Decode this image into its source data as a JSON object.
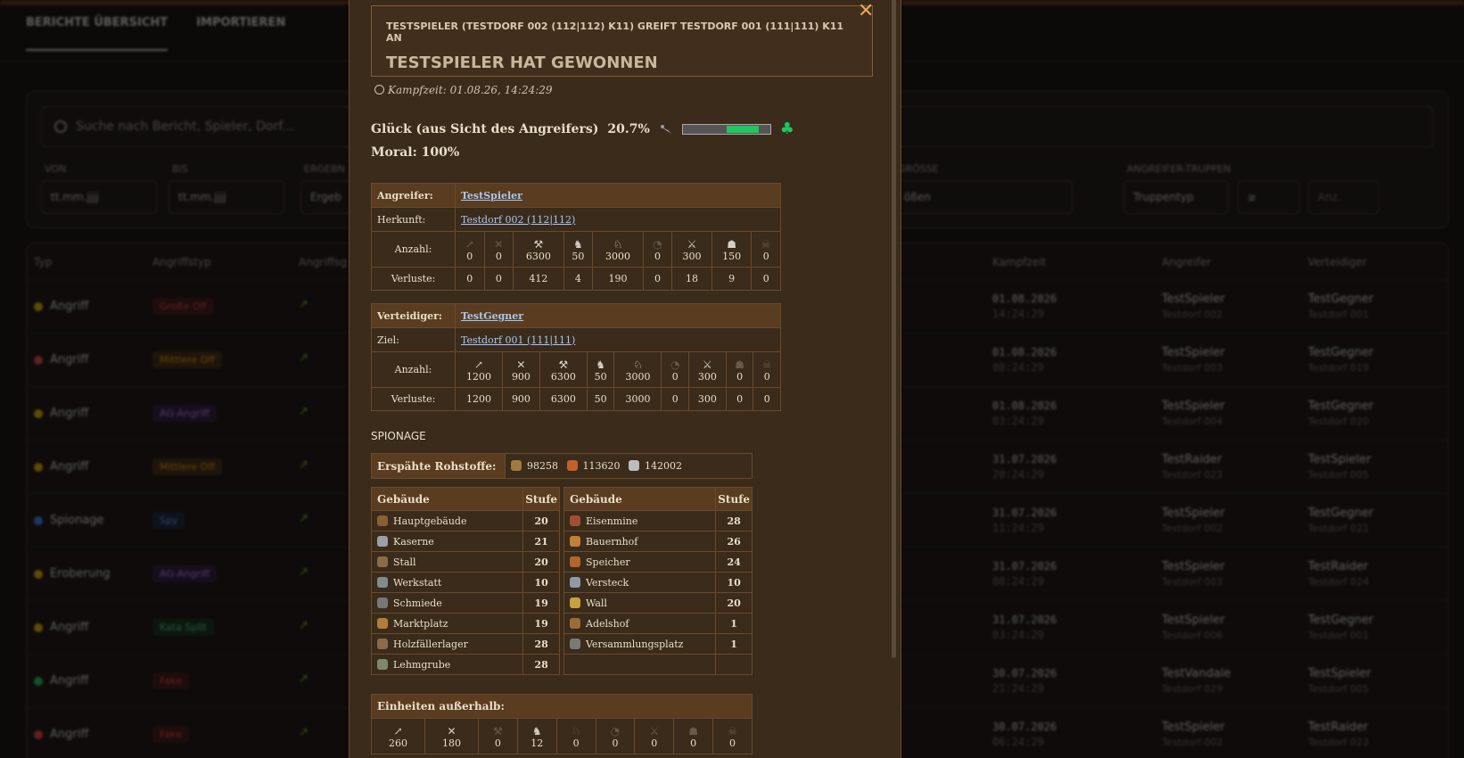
{
  "background": {
    "tabs": [
      "BERICHTE ÜBERSICHT",
      "IMPORTIEREN"
    ],
    "search_placeholder": "Suche nach Bericht, Spieler, Dorf...",
    "filters": {
      "von_label": "VON",
      "von_value": "tt.mm.jjjj",
      "bis_label": "BIS",
      "bis_value": "tt.mm.jjjj",
      "ergebnis_label": "ERGEBN",
      "ergebnis_value": "Ergeb",
      "groesse_label": "GRÖSSE",
      "groesse_value": "ößen",
      "truppen_label": "ANGREIFER-TRUPPEN",
      "truppen_value": "Truppentyp",
      "op_value": "≥",
      "anz_placeholder": "Anz."
    },
    "table_headers": {
      "typ": "Typ",
      "angriffstyp": "Angriffstyp",
      "angriffsg": "Angriffsg",
      "kampfzeit": "Kampfzeit",
      "angreifer": "Angreifer",
      "verteidiger": "Verteidiger"
    },
    "rows": [
      {
        "typ": "Angriff",
        "dot": "#eab308",
        "badge": "Große Off",
        "badge_color": "#ef4444",
        "badge_bg": "#3b1212",
        "date": "01.08.2026",
        "time": "14:24:29",
        "att": "TestSpieler",
        "att_v": "Testdorf 002",
        "def": "TestGegner",
        "def_v": "Testdorf 001"
      },
      {
        "typ": "Angriff",
        "dot": "#ef4444",
        "badge": "Mittlere Off",
        "badge_color": "#f59e0b",
        "badge_bg": "#3b2a0c",
        "date": "01.08.2026",
        "time": "08:24:29",
        "att": "TestSpieler",
        "att_v": "Testdorf 003",
        "def": "TestGegner",
        "def_v": "Testdorf 019"
      },
      {
        "typ": "Angriff",
        "dot": "#eab308",
        "badge": "AG-Angriff",
        "badge_color": "#c084fc",
        "badge_bg": "#2a153d",
        "date": "01.08.2026",
        "time": "03:24:29",
        "att": "TestSpieler",
        "att_v": "Testdorf 004",
        "def": "TestGegner",
        "def_v": "Testdorf 020"
      },
      {
        "typ": "Angriff",
        "dot": "#eab308",
        "badge": "Mittlere Off",
        "badge_color": "#f59e0b",
        "badge_bg": "#3b2a0c",
        "date": "31.07.2026",
        "time": "20:24:29",
        "att": "TestRaider",
        "att_v": "Testdorf 023",
        "def": "TestSpieler",
        "def_v": "Testdorf 005"
      },
      {
        "typ": "Spionage",
        "dot": "#3b82f6",
        "badge": "Spy",
        "badge_color": "#60a5fa",
        "badge_bg": "#12213b",
        "date": "31.07.2026",
        "time": "11:24:29",
        "att": "TestSpieler",
        "att_v": "Testdorf 002",
        "def": "TestGegner",
        "def_v": "Testdorf 021"
      },
      {
        "typ": "Eroberung",
        "dot": "#eab308",
        "badge": "AG-Angriff",
        "badge_color": "#c084fc",
        "badge_bg": "#2a153d",
        "date": "31.07.2026",
        "time": "08:24:29",
        "att": "TestSpieler",
        "att_v": "Testdorf 003",
        "def": "TestRaider",
        "def_v": "Testdorf 024"
      },
      {
        "typ": "Angriff",
        "dot": "#eab308",
        "badge": "Kata Split",
        "badge_color": "#4ade80",
        "badge_bg": "#0f2e1a",
        "date": "31.07.2026",
        "time": "03:24:29",
        "att": "TestSpieler",
        "att_v": "Testdorf 006",
        "def": "TestGegner",
        "def_v": "Testdorf 001"
      },
      {
        "typ": "Angriff",
        "dot": "#22c55e",
        "badge": "Fake",
        "badge_color": "#ef4444",
        "badge_bg": "#3b1212",
        "date": "30.07.2026",
        "time": "21:24:29",
        "att": "TestVandale",
        "att_v": "Testdorf 029",
        "def": "TestSpieler",
        "def_v": "Testdorf 005"
      },
      {
        "typ": "Angriff",
        "dot": "#ef4444",
        "badge": "Fake",
        "badge_color": "#ef4444",
        "badge_bg": "#3b1212",
        "date": "30.07.2026",
        "time": "06:24:29",
        "att": "TestSpieler",
        "att_v": "Testdorf 002",
        "def": "TestRaider",
        "def_v": "Testdorf 023"
      }
    ]
  },
  "modal": {
    "headline": "TESTSPIELER (TESTDORF 002 (112|112) K11) GREIFT TESTDORF 001 (111|111) K11 AN",
    "result": "TESTSPIELER HAT GEWONNEN",
    "kampfzeit": "Kampfzeit: 01.08.26, 14:24:29",
    "glueck_label": "Glück (aus Sicht des Angreifers)",
    "glueck_value": "20.7%",
    "glueck_fraction": 0.207,
    "moral": "Moral: 100%",
    "attacker": {
      "role": "Angreifer:",
      "name": "TestSpieler",
      "origin_label": "Herkunft:",
      "origin": "Testdorf 002 (112|112)",
      "count_label": "Anzahl:",
      "loss_label": "Verluste:",
      "counts": [
        "0",
        "0",
        "6300",
        "50",
        "3000",
        "0",
        "300",
        "150",
        "0"
      ],
      "losses": [
        "0",
        "0",
        "412",
        "4",
        "190",
        "0",
        "18",
        "9",
        "0"
      ]
    },
    "defender": {
      "role": "Verteidiger:",
      "name": "TestGegner",
      "origin_label": "Ziel:",
      "origin": "Testdorf 001 (111|111)",
      "count_label": "Anzahl:",
      "loss_label": "Verluste:",
      "counts": [
        "1200",
        "900",
        "6300",
        "50",
        "3000",
        "0",
        "300",
        "0",
        "0"
      ],
      "losses": [
        "1200",
        "900",
        "6300",
        "50",
        "3000",
        "0",
        "300",
        "0",
        "0"
      ]
    },
    "spionage_title": "SPIONAGE",
    "resources_label": "Erspähte Rohstoffe:",
    "resources": [
      "98258",
      "113620",
      "142002"
    ],
    "buildings_header": "Gebäude",
    "level_header": "Stufe",
    "buildings_left": [
      {
        "name": "Hauptgebäude",
        "level": "20"
      },
      {
        "name": "Kaserne",
        "level": "21"
      },
      {
        "name": "Stall",
        "level": "20"
      },
      {
        "name": "Werkstatt",
        "level": "10"
      },
      {
        "name": "Schmiede",
        "level": "19"
      },
      {
        "name": "Marktplatz",
        "level": "19"
      },
      {
        "name": "Holzfällerlager",
        "level": "28"
      },
      {
        "name": "Lehmgrube",
        "level": "28"
      }
    ],
    "buildings_right": [
      {
        "name": "Eisenmine",
        "level": "28"
      },
      {
        "name": "Bauernhof",
        "level": "26"
      },
      {
        "name": "Speicher",
        "level": "24"
      },
      {
        "name": "Versteck",
        "level": "10"
      },
      {
        "name": "Wall",
        "level": "20"
      },
      {
        "name": "Adelshof",
        "level": "1"
      },
      {
        "name": "Versammlungsplatz",
        "level": "1"
      }
    ],
    "outside_label": "Einheiten außerhalb:",
    "outside_counts": [
      "260",
      "180",
      "0",
      "12",
      "0",
      "0",
      "0",
      "0",
      "0"
    ]
  }
}
